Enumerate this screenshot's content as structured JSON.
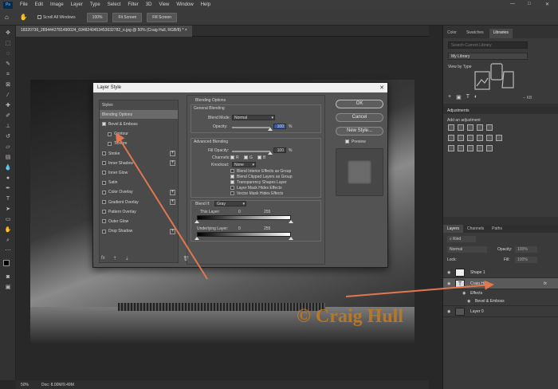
{
  "menubar": {
    "logo": "Ps",
    "items": [
      "File",
      "Edit",
      "Image",
      "Layer",
      "Type",
      "Select",
      "Filter",
      "3D",
      "View",
      "Window",
      "Help"
    ],
    "window_controls": [
      "—",
      "□",
      "✕"
    ]
  },
  "options_bar": {
    "scroll_all": "Scroll All Windows",
    "zoom_100": "100%",
    "fit_screen": "Fit Screen",
    "fill_screen": "Fill Screen"
  },
  "document": {
    "tab_title": "18320736_2894442781490024_6948240453453632782_o.jpg @ 50% (Craig Hull, RGB/8) *",
    "watermark": "© Craig Hull"
  },
  "status_bar": {
    "zoom": "50%",
    "doc": "Doc: 8.00M/9.49M"
  },
  "dialog": {
    "title": "Layer Style",
    "close": "✕",
    "styles_list": [
      {
        "label": "Styles",
        "checkbox": false,
        "plus": false,
        "selected": false
      },
      {
        "label": "Blending Options",
        "checkbox": false,
        "plus": false,
        "selected": true
      },
      {
        "label": "Bevel & Emboss",
        "checkbox": true,
        "checked": true,
        "plus": false,
        "selected": false
      },
      {
        "label": "Contour",
        "checkbox": true,
        "checked": false,
        "plus": false,
        "selected": false,
        "indent": true
      },
      {
        "label": "Texture",
        "checkbox": true,
        "checked": false,
        "plus": false,
        "selected": false,
        "indent": true
      },
      {
        "label": "Stroke",
        "checkbox": true,
        "checked": false,
        "plus": true,
        "selected": false
      },
      {
        "label": "Inner Shadow",
        "checkbox": true,
        "checked": false,
        "plus": true,
        "selected": false
      },
      {
        "label": "Inner Glow",
        "checkbox": true,
        "checked": false,
        "plus": false,
        "selected": false
      },
      {
        "label": "Satin",
        "checkbox": true,
        "checked": false,
        "plus": false,
        "selected": false
      },
      {
        "label": "Color Overlay",
        "checkbox": true,
        "checked": false,
        "plus": true,
        "selected": false
      },
      {
        "label": "Gradient Overlay",
        "checkbox": true,
        "checked": false,
        "plus": true,
        "selected": false
      },
      {
        "label": "Pattern Overlay",
        "checkbox": true,
        "checked": false,
        "plus": false,
        "selected": false
      },
      {
        "label": "Outer Glow",
        "checkbox": true,
        "checked": false,
        "plus": false,
        "selected": false
      },
      {
        "label": "Drop Shadow",
        "checkbox": true,
        "checked": false,
        "plus": true,
        "selected": false
      }
    ],
    "blending": {
      "section": "Blending Options",
      "general": "General Blending",
      "blend_mode_label": "Blend Mode:",
      "blend_mode": "Normal",
      "opacity_label": "Opacity:",
      "opacity": "100",
      "percent": "%",
      "advanced": "Advanced Blending",
      "fill_opacity_label": "Fill Opacity:",
      "fill_opacity": "100",
      "channels_label": "Channels:",
      "channel_r": "R",
      "channel_g": "G",
      "channel_b": "B",
      "knockout_label": "Knockout:",
      "knockout": "None",
      "opt1": "Blend Interior Effects as Group",
      "opt2": "Blend Clipped Layers as Group",
      "opt3": "Transparency Shapes Layer",
      "opt4": "Layer Mask Hides Effects",
      "opt5": "Vector Mask Hides Effects",
      "blend_if_label": "Blend If:",
      "blend_if": "Gray",
      "this_layer": "This Layer:",
      "underlying": "Underlying Layer:",
      "v0": "0",
      "v255": "255"
    },
    "buttons": {
      "ok": "OK",
      "cancel": "Cancel",
      "new_style": "New Style...",
      "preview": "Preview"
    }
  },
  "libraries": {
    "tabs": [
      "Color",
      "Swatches",
      "Libraries"
    ],
    "search_placeholder": "Search Current Library",
    "library": "My Library",
    "view_by": "View by Type",
    "size": "-- KB"
  },
  "adjustments": {
    "title": "Adjustments",
    "add": "Add an adjustment"
  },
  "layers": {
    "tabs": [
      "Layers",
      "Channels",
      "Paths"
    ],
    "kind": "Kind",
    "mode": "Normal",
    "opacity_label": "Opacity:",
    "opacity": "100%",
    "lock_label": "Lock:",
    "fill_label": "Fill:",
    "fill": "100%",
    "rows": [
      {
        "name": "Shape 1",
        "selected": false
      },
      {
        "name": "Craig Hull",
        "selected": true,
        "fx": "fx"
      },
      {
        "name": "Effects",
        "selected": false,
        "sub": true
      },
      {
        "name": "Bevel & Emboss",
        "selected": false,
        "sub": true
      },
      {
        "name": "Layer 0",
        "selected": false
      }
    ]
  },
  "colors": {
    "menubar": "#3c3c3c",
    "panel": "#323232",
    "dialog": "#535353",
    "arrow": "#e0774f",
    "watermark": "#c17a23"
  }
}
